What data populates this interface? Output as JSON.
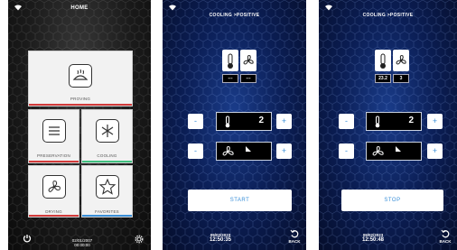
{
  "home": {
    "title": "HOME",
    "tiles": {
      "proving": "PROVING",
      "preservation": "PRESERVATION",
      "cooling": "COOLING",
      "drying": "DRYING",
      "favorites": "FAVORITES"
    },
    "date": "02/01/2007",
    "time": "00:00:00"
  },
  "screen2": {
    "title": "COOLING >POSITIVE",
    "readout_temp": "---",
    "readout_fan": "---",
    "set_temp": "2",
    "minus": "-",
    "plus": "+",
    "action": "START",
    "date": "09/02/2023",
    "time": "12:50:35",
    "back": "BACK"
  },
  "screen3": {
    "title": "COOLING >POSITIVE",
    "readout_temp": "23.2",
    "readout_fan": "3",
    "set_temp": "2",
    "minus": "-",
    "plus": "+",
    "action": "STOP",
    "date": "09/02/2023",
    "time": "12:50:48",
    "back": "BACK"
  },
  "colors": {
    "accent_blue": "#3a8fd8",
    "cooling_green": "#3fbf7f",
    "proving_red": "#d23a3a"
  }
}
